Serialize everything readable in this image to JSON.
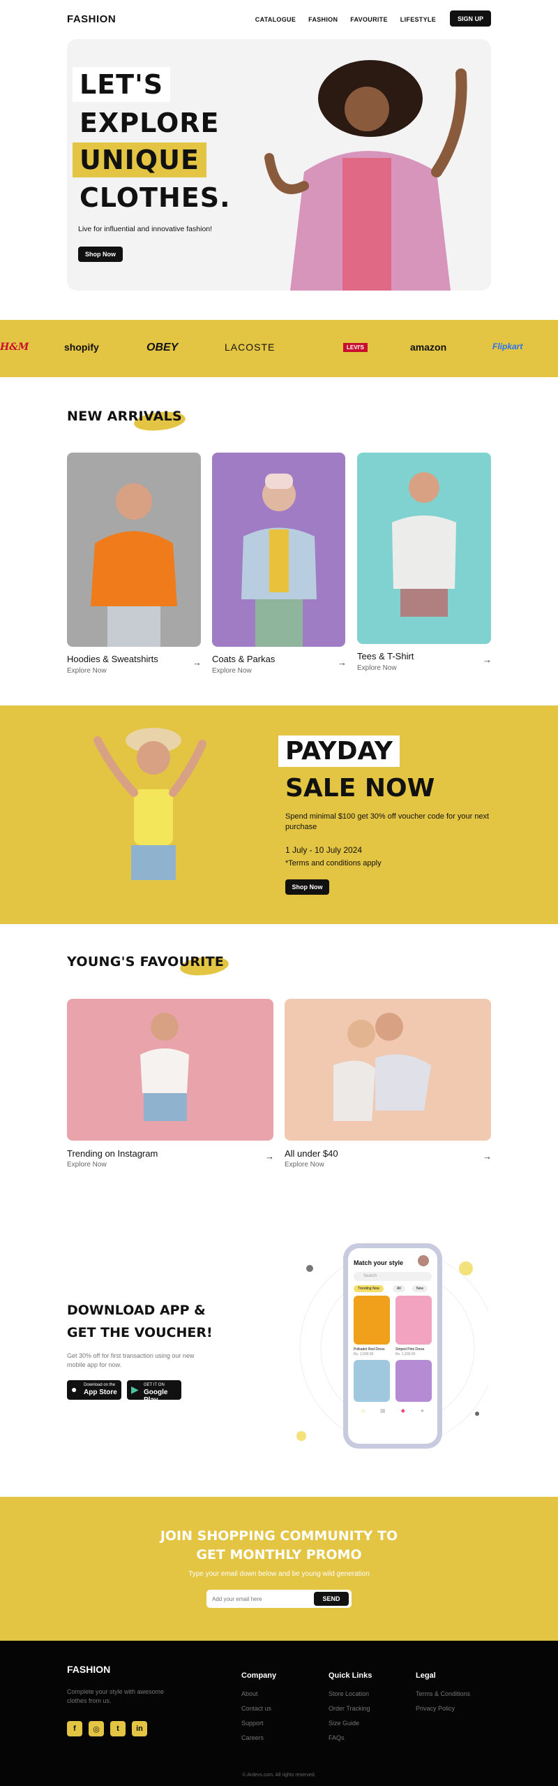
{
  "nav": {
    "brand": "FASHION",
    "links": [
      "CATALOGUE",
      "FASHION",
      "FAVOURITE",
      "LIFESTYLE"
    ],
    "signup": "SIGN UP"
  },
  "hero": {
    "words": [
      "LET'S",
      "EXPLORE",
      "UNIQUE",
      "CLOTHES."
    ],
    "subtitle": "Live for influential and innovative fashion!",
    "cta": "Shop Now"
  },
  "brands": [
    "H&M",
    "shopify",
    "OBEY",
    "LACOSTE",
    "LEVI'S",
    "amazon",
    "Flipkart"
  ],
  "new_arrivals": {
    "title": "NEW ARRIVALS",
    "items": [
      {
        "title": "Hoodies & Sweatshirts",
        "sub": "Explore Now"
      },
      {
        "title": "Coats & Parkas",
        "sub": "Explore Now"
      },
      {
        "title": "Tees & T-Shirt",
        "sub": "Explore Now"
      }
    ]
  },
  "payday": {
    "line1": "PAYDAY",
    "line2": "SALE NOW",
    "desc": "Spend minimal $100 get 30% off voucher code for your next purchase",
    "dates": "1 July - 10 July 2024",
    "terms": "*Terms and conditions apply",
    "cta": "Shop Now"
  },
  "favourite": {
    "title": "YOUNG'S FAVOURITE",
    "items": [
      {
        "title": "Trending on Instagram",
        "sub": "Explore Now"
      },
      {
        "title": "All under $40",
        "sub": "Explore Now"
      }
    ]
  },
  "app": {
    "title1": "DOWNLOAD APP &",
    "title2": "GET THE VOUCHER!",
    "desc": "Get 30% off for first transaction using our new mobile app for now.",
    "appstore_small": "Download on the",
    "appstore": "App Store",
    "gplay_small": "GET IT ON",
    "gplay": "Google Play",
    "phone": {
      "heading": "Match your style",
      "search": "Search",
      "chips": [
        "Trending Now",
        "All",
        "New"
      ],
      "products": [
        {
          "name": "Polkadot Red Dress",
          "price": "Rs. 1,500.00"
        },
        {
          "name": "Striped Pink Dress",
          "price": "Rs. 1,200.00"
        }
      ]
    }
  },
  "community": {
    "title1": "JOIN SHOPPING COMMUNITY TO",
    "title2": "GET MONTHLY PROMO",
    "sub": "Type your email down below and be young wild generation",
    "placeholder": "Add your email here",
    "send": "SEND"
  },
  "footer": {
    "brand": "FASHION",
    "desc": "Complete your style with awesome clothes from us.",
    "social": [
      "f",
      "ig",
      "tw",
      "in"
    ],
    "columns": [
      {
        "heading": "Company",
        "items": [
          "About",
          "Contact us",
          "Support",
          "Careers"
        ]
      },
      {
        "heading": "Quick Links",
        "items": [
          "Store Location",
          "Order Tracking",
          "Size Guide",
          "FAQs"
        ]
      },
      {
        "heading": "Legal",
        "items": [
          "Terms & Conditions",
          "Privacy Policy"
        ]
      }
    ],
    "copyright": "© Ardevs.com. All rights reserved."
  },
  "colors": {
    "accent": "#e4c443",
    "dark": "#111111"
  }
}
